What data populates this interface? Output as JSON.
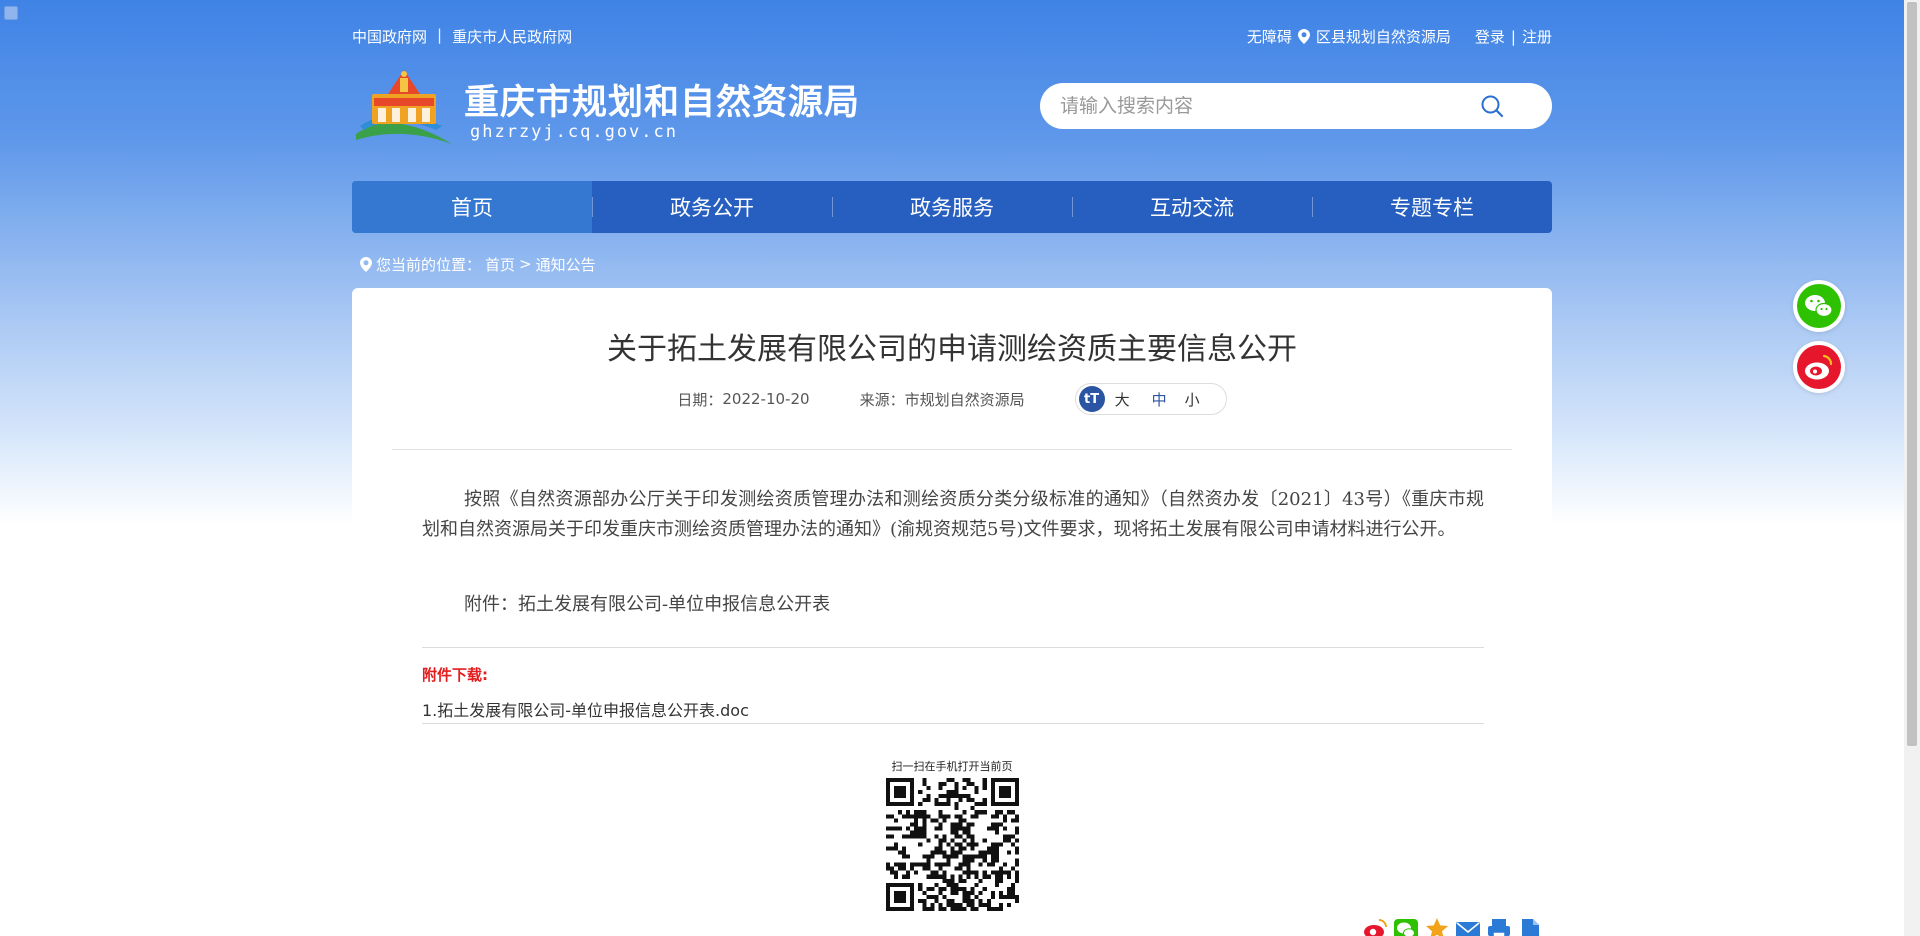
{
  "topbar": {
    "link_gov": "中国政府网",
    "separator": "|",
    "link_cq": "重庆市人民政府网",
    "accessibility": "无障碍",
    "district": "区县规划自然资源局",
    "login": "登录",
    "separator2": "|",
    "register": "注册"
  },
  "header": {
    "site_title": "重庆市规划和自然资源局",
    "site_domain": "ghzrzyj.cq.gov.cn",
    "search_placeholder": "请输入搜索内容"
  },
  "nav": {
    "items": [
      {
        "label": "首页",
        "active": true
      },
      {
        "label": "政务公开"
      },
      {
        "label": "政务服务"
      },
      {
        "label": "互动交流"
      },
      {
        "label": "专题专栏"
      }
    ]
  },
  "breadcrumb": {
    "prefix": "您当前的位置：",
    "home": "首页",
    "sep": ">",
    "current": "通知公告"
  },
  "article": {
    "title": "关于拓土发展有限公司的申请测绘资质主要信息公开",
    "date_label": "日期：",
    "date": "2022-10-20",
    "source_label": "来源：",
    "source": "市规划自然资源局",
    "font_icon": "tT",
    "font_large": "大",
    "font_medium": "中",
    "font_small": "小",
    "body": "按照《自然资源部办公厅关于印发测绘资质管理办法和测绘资质分类分级标准的通知》（自然资办发〔2021〕43号）《重庆市规划和自然资源局关于印发重庆市测绘资质管理办法的通知》(渝规资规范5号)文件要求，现将拓土发展有限公司申请材料进行公开。",
    "attachment_line": "附件：拓土发展有限公司-单位申报信息公开表",
    "download_label": "附件下载:",
    "download_file": "1.拓土发展有限公司-单位申报信息公开表.doc",
    "qr_label": "扫一扫在手机打开当前页"
  },
  "colors": {
    "nav_bg": "#265fc0",
    "nav_active": "#3578d2",
    "download_label": "#e31d1d",
    "wechat": "#2dc100",
    "weibo": "#e6162d"
  },
  "icons": {
    "search": "search-icon",
    "location": "location-pin-icon",
    "wechat": "wechat-icon",
    "weibo": "weibo-icon"
  }
}
